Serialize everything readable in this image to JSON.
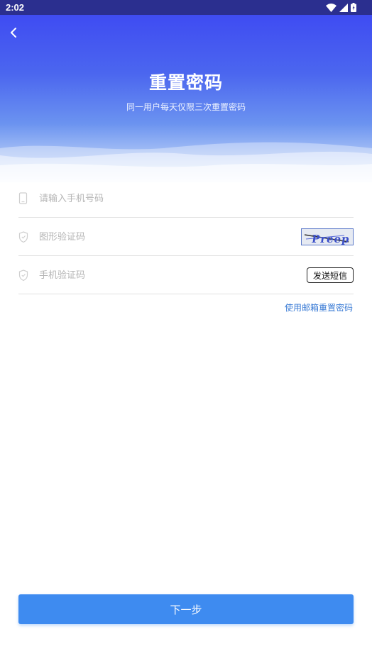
{
  "status_bar": {
    "time": "2:02",
    "icons": [
      "wifi-icon",
      "signal-icon",
      "battery-icon"
    ]
  },
  "header": {
    "title": "重置密码",
    "subtitle": "同一用户每天仅限三次重置密码"
  },
  "form": {
    "phone": {
      "placeholder": "请输入手机号码",
      "value": ""
    },
    "image_captcha": {
      "placeholder": "图形验证码",
      "value": "",
      "captcha_text": "Preep"
    },
    "sms_code": {
      "placeholder": "手机验证码",
      "value": "",
      "send_label": "发送短信"
    }
  },
  "email_reset_link": "使用邮箱重置密码",
  "next_button": "下一步",
  "colors": {
    "status_bar": "#2b2f8f",
    "header_gradient_top": "#3f4cf2",
    "primary_button": "#3e8bf0",
    "link": "#3a7bd5"
  }
}
